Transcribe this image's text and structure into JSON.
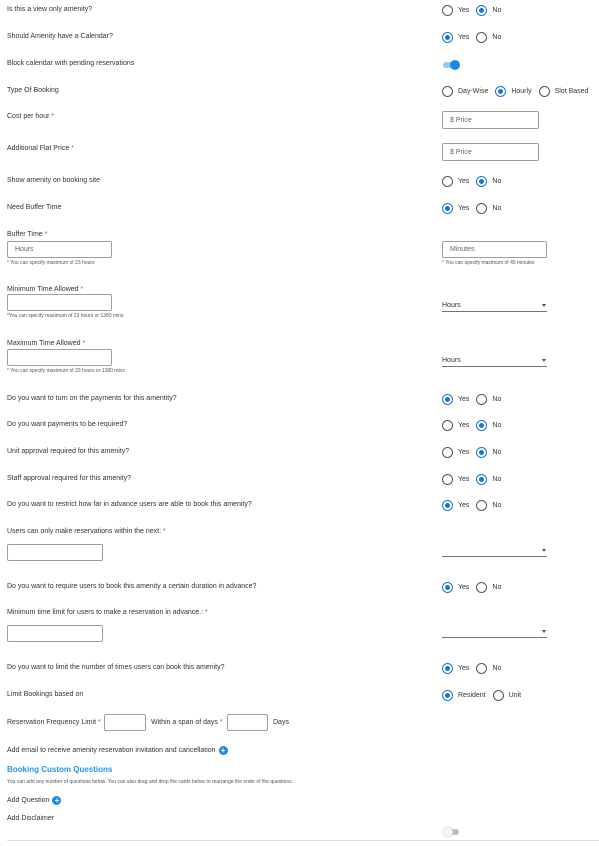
{
  "colors": {
    "accent": "#1976d2",
    "required": "#e53935",
    "section_title": "#2196f3"
  },
  "rows": {
    "view_only": {
      "label": "Is this a view only amenity?",
      "options": [
        "Yes",
        "No"
      ],
      "selected": "No"
    },
    "calendar": {
      "label": "Should Amenity have a Calendar?",
      "options": [
        "Yes",
        "No"
      ],
      "selected": "Yes"
    },
    "block_calendar": {
      "label": "Block calendar with pending reservations",
      "toggle_on": true
    },
    "booking_type": {
      "label": "Type Of Booking",
      "options": [
        "Day-Wise",
        "Hourly",
        "Slot Based"
      ],
      "selected": "Hourly"
    },
    "cost_per_hour": {
      "label": "Cost per hour",
      "required": "*",
      "placeholder": "$ Price"
    },
    "flat_price": {
      "label": "Additional Flat Price",
      "required": "*",
      "placeholder": "$ Price"
    },
    "show_amenity": {
      "label": "Show amenity on booking site",
      "options": [
        "Yes",
        "No"
      ],
      "selected": "No"
    },
    "buffer_needed": {
      "label": "Need Buffer Time",
      "options": [
        "Yes",
        "No"
      ],
      "selected": "Yes"
    },
    "buffer_time": {
      "label": "Buffer Time",
      "required": "*",
      "hours_placeholder": "Hours",
      "hours_hint": "* You can specify maximum of 23 hours",
      "minutes_placeholder": "Minutes",
      "minutes_hint": "* You can specify maximum of 45 minutes"
    },
    "min_time": {
      "label": "Minimum Time Allowed",
      "required": "*",
      "hint": "*You can specify maximum of 23 hours or 1380 mins",
      "unit": "Hours"
    },
    "max_time": {
      "label": "Maximum Time Allowed",
      "required": "*",
      "hint": "* You can specify maximum of 23 hours or 1380 mins",
      "unit": "Hours"
    },
    "payments_on": {
      "label": "Do you want to turn on the payments for this amentity?",
      "options": [
        "Yes",
        "No"
      ],
      "selected": "Yes"
    },
    "payments_required": {
      "label": "Do you want payments to be required?",
      "options": [
        "Yes",
        "No"
      ],
      "selected": "No"
    },
    "unit_approval": {
      "label": "Unit approval required for this amenity?",
      "options": [
        "Yes",
        "No"
      ],
      "selected": "No"
    },
    "staff_approval": {
      "label": "Staff approval required for this amenity?",
      "options": [
        "Yes",
        "No"
      ],
      "selected": "No"
    },
    "restrict_advance": {
      "label": "Do you want to restrict how far in advance users are able to book this amenity?",
      "options": [
        "Yes",
        "No"
      ],
      "selected": "Yes"
    },
    "within_next": {
      "label": "Users can only make reservations within the next:",
      "required": "*"
    },
    "duration_advance": {
      "label": "Do you want to require users to book this amenity a certain duration in advance?",
      "options": [
        "Yes",
        "No"
      ],
      "selected": "Yes"
    },
    "min_limit": {
      "label": "Minimum time limit for users to make a reservation in advance.:",
      "required": "*"
    },
    "limit_times": {
      "label": "Do you want to limit the number of times users can book this amenity?",
      "options": [
        "Yes",
        "No"
      ],
      "selected": "Yes"
    },
    "limit_based": {
      "label": "Limit Bookings based on",
      "options": [
        "Resident",
        "Unit"
      ],
      "selected": "Resident"
    },
    "frequency": {
      "label": "Reservation Frequency Limit",
      "required": "*",
      "span_label": "Within a span of days",
      "days_label": "Days"
    },
    "add_email": {
      "label": "Add email to receive amenity reservation invitation and cancellation",
      "icon": "plus-circle-icon"
    }
  },
  "custom_questions": {
    "title": "Booking Custom Questions",
    "description": "You can add any number of questions below. You can also drag and drop the cards below to rearrange the order of the questions.",
    "add_question": "Add Question",
    "add_disclaimer": "Add Disclaimer",
    "disclaimer_toggle_on": false
  }
}
